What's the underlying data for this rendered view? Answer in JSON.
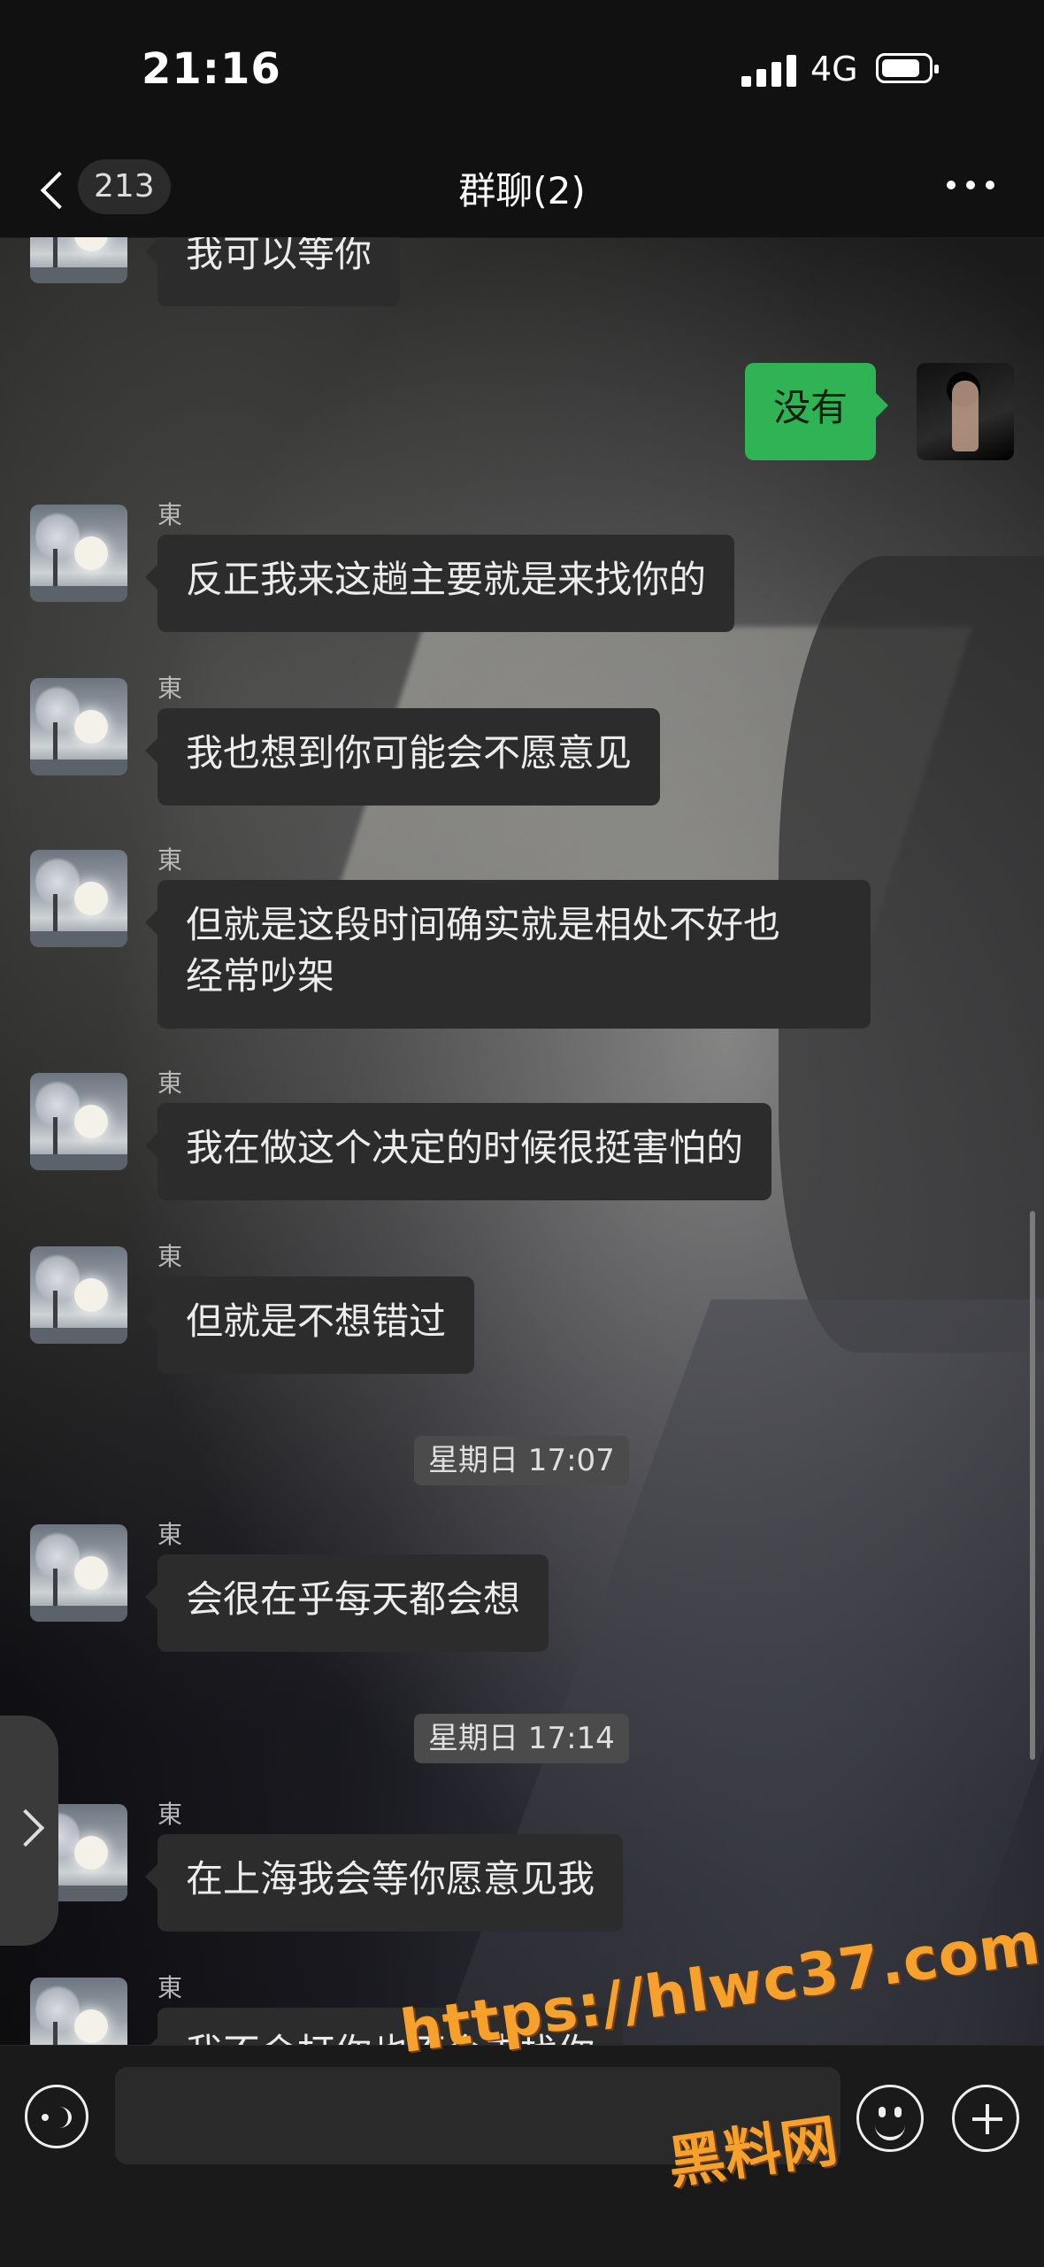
{
  "status_bar": {
    "time": "21:16",
    "network": "4G"
  },
  "nav": {
    "unread_count": "213",
    "title": "群聊(2)"
  },
  "messages": [
    {
      "sender": "",
      "text": "我可以等你",
      "side": "left"
    },
    {
      "sender": "",
      "text": "没有",
      "side": "right"
    },
    {
      "sender": "東",
      "text": "反正我来这趟主要就是来找你的",
      "side": "left"
    },
    {
      "sender": "東",
      "text": "我也想到你可能会不愿意见",
      "side": "left"
    },
    {
      "sender": "東",
      "text": "但就是这段时间确实就是相处不好也\n经常吵架",
      "side": "left"
    },
    {
      "sender": "東",
      "text": "我在做这个决定的时候很挺害怕的",
      "side": "left"
    },
    {
      "sender": "東",
      "text": "但就是不想错过",
      "side": "left"
    },
    {
      "sender": "東",
      "text": "会很在乎每天都会想",
      "side": "left"
    },
    {
      "sender": "東",
      "text": "在上海我会等你愿意见我",
      "side": "left"
    },
    {
      "sender": "東",
      "text": "我不会打你也不会去找你",
      "side": "left"
    }
  ],
  "timestamps": [
    "星期日 17:07",
    "星期日 17:14"
  ],
  "icons": {
    "back": "chevron-left-icon",
    "more": "more-dots-icon",
    "voice": "voice-icon",
    "emoji": "emoji-icon",
    "plus": "plus-icon",
    "expand": "chevron-right-icon"
  },
  "colors": {
    "outgoing_bubble": "#2fb355",
    "incoming_bubble": "#2c2c2c",
    "watermark": "#f6a12b"
  },
  "watermark": {
    "url": "https://hlwc37.com",
    "label": "黑料网"
  }
}
